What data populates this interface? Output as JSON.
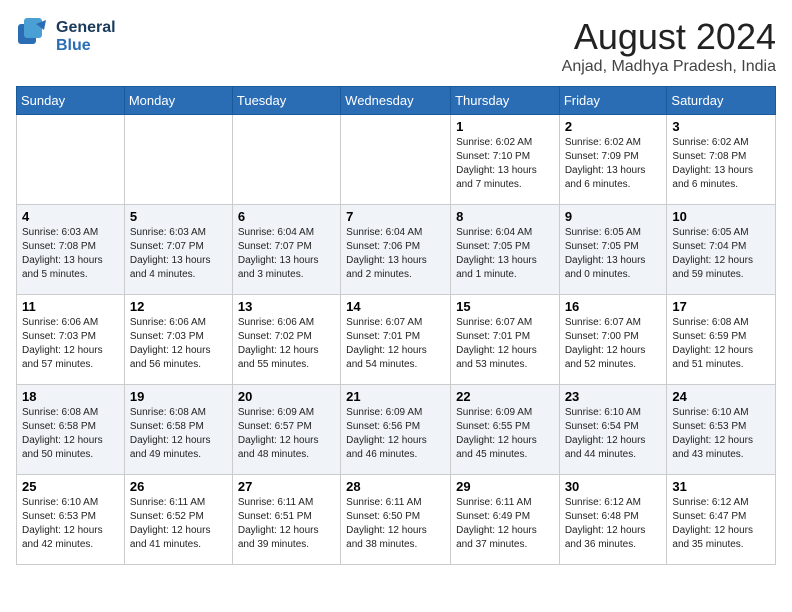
{
  "header": {
    "logo_general": "General",
    "logo_blue": "Blue",
    "month_title": "August 2024",
    "location": "Anjad, Madhya Pradesh, India"
  },
  "days_of_week": [
    "Sunday",
    "Monday",
    "Tuesday",
    "Wednesday",
    "Thursday",
    "Friday",
    "Saturday"
  ],
  "weeks": [
    {
      "days": [
        {
          "num": "",
          "info": ""
        },
        {
          "num": "",
          "info": ""
        },
        {
          "num": "",
          "info": ""
        },
        {
          "num": "",
          "info": ""
        },
        {
          "num": "1",
          "info": "Sunrise: 6:02 AM\nSunset: 7:10 PM\nDaylight: 13 hours\nand 7 minutes."
        },
        {
          "num": "2",
          "info": "Sunrise: 6:02 AM\nSunset: 7:09 PM\nDaylight: 13 hours\nand 6 minutes."
        },
        {
          "num": "3",
          "info": "Sunrise: 6:02 AM\nSunset: 7:08 PM\nDaylight: 13 hours\nand 6 minutes."
        }
      ]
    },
    {
      "days": [
        {
          "num": "4",
          "info": "Sunrise: 6:03 AM\nSunset: 7:08 PM\nDaylight: 13 hours\nand 5 minutes."
        },
        {
          "num": "5",
          "info": "Sunrise: 6:03 AM\nSunset: 7:07 PM\nDaylight: 13 hours\nand 4 minutes."
        },
        {
          "num": "6",
          "info": "Sunrise: 6:04 AM\nSunset: 7:07 PM\nDaylight: 13 hours\nand 3 minutes."
        },
        {
          "num": "7",
          "info": "Sunrise: 6:04 AM\nSunset: 7:06 PM\nDaylight: 13 hours\nand 2 minutes."
        },
        {
          "num": "8",
          "info": "Sunrise: 6:04 AM\nSunset: 7:05 PM\nDaylight: 13 hours\nand 1 minute."
        },
        {
          "num": "9",
          "info": "Sunrise: 6:05 AM\nSunset: 7:05 PM\nDaylight: 13 hours\nand 0 minutes."
        },
        {
          "num": "10",
          "info": "Sunrise: 6:05 AM\nSunset: 7:04 PM\nDaylight: 12 hours\nand 59 minutes."
        }
      ]
    },
    {
      "days": [
        {
          "num": "11",
          "info": "Sunrise: 6:06 AM\nSunset: 7:03 PM\nDaylight: 12 hours\nand 57 minutes."
        },
        {
          "num": "12",
          "info": "Sunrise: 6:06 AM\nSunset: 7:03 PM\nDaylight: 12 hours\nand 56 minutes."
        },
        {
          "num": "13",
          "info": "Sunrise: 6:06 AM\nSunset: 7:02 PM\nDaylight: 12 hours\nand 55 minutes."
        },
        {
          "num": "14",
          "info": "Sunrise: 6:07 AM\nSunset: 7:01 PM\nDaylight: 12 hours\nand 54 minutes."
        },
        {
          "num": "15",
          "info": "Sunrise: 6:07 AM\nSunset: 7:01 PM\nDaylight: 12 hours\nand 53 minutes."
        },
        {
          "num": "16",
          "info": "Sunrise: 6:07 AM\nSunset: 7:00 PM\nDaylight: 12 hours\nand 52 minutes."
        },
        {
          "num": "17",
          "info": "Sunrise: 6:08 AM\nSunset: 6:59 PM\nDaylight: 12 hours\nand 51 minutes."
        }
      ]
    },
    {
      "days": [
        {
          "num": "18",
          "info": "Sunrise: 6:08 AM\nSunset: 6:58 PM\nDaylight: 12 hours\nand 50 minutes."
        },
        {
          "num": "19",
          "info": "Sunrise: 6:08 AM\nSunset: 6:58 PM\nDaylight: 12 hours\nand 49 minutes."
        },
        {
          "num": "20",
          "info": "Sunrise: 6:09 AM\nSunset: 6:57 PM\nDaylight: 12 hours\nand 48 minutes."
        },
        {
          "num": "21",
          "info": "Sunrise: 6:09 AM\nSunset: 6:56 PM\nDaylight: 12 hours\nand 46 minutes."
        },
        {
          "num": "22",
          "info": "Sunrise: 6:09 AM\nSunset: 6:55 PM\nDaylight: 12 hours\nand 45 minutes."
        },
        {
          "num": "23",
          "info": "Sunrise: 6:10 AM\nSunset: 6:54 PM\nDaylight: 12 hours\nand 44 minutes."
        },
        {
          "num": "24",
          "info": "Sunrise: 6:10 AM\nSunset: 6:53 PM\nDaylight: 12 hours\nand 43 minutes."
        }
      ]
    },
    {
      "days": [
        {
          "num": "25",
          "info": "Sunrise: 6:10 AM\nSunset: 6:53 PM\nDaylight: 12 hours\nand 42 minutes."
        },
        {
          "num": "26",
          "info": "Sunrise: 6:11 AM\nSunset: 6:52 PM\nDaylight: 12 hours\nand 41 minutes."
        },
        {
          "num": "27",
          "info": "Sunrise: 6:11 AM\nSunset: 6:51 PM\nDaylight: 12 hours\nand 39 minutes."
        },
        {
          "num": "28",
          "info": "Sunrise: 6:11 AM\nSunset: 6:50 PM\nDaylight: 12 hours\nand 38 minutes."
        },
        {
          "num": "29",
          "info": "Sunrise: 6:11 AM\nSunset: 6:49 PM\nDaylight: 12 hours\nand 37 minutes."
        },
        {
          "num": "30",
          "info": "Sunrise: 6:12 AM\nSunset: 6:48 PM\nDaylight: 12 hours\nand 36 minutes."
        },
        {
          "num": "31",
          "info": "Sunrise: 6:12 AM\nSunset: 6:47 PM\nDaylight: 12 hours\nand 35 minutes."
        }
      ]
    }
  ]
}
